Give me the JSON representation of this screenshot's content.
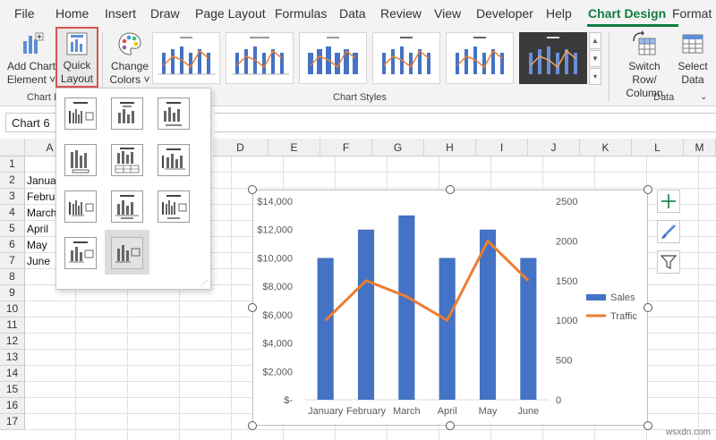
{
  "menu": {
    "tabs": [
      "File",
      "Home",
      "Insert",
      "Draw",
      "Page Layout",
      "Formulas",
      "Data",
      "Review",
      "View",
      "Developer",
      "Help",
      "Chart Design",
      "Format"
    ],
    "active": "Chart Design"
  },
  "ribbon": {
    "add_chart_element": [
      "Add Chart",
      "Element"
    ],
    "quick_layout": [
      "Quick",
      "Layout"
    ],
    "change_colors": [
      "Change",
      "Colors"
    ],
    "switch_row_column": [
      "Switch Row/",
      "Column"
    ],
    "select_data": [
      "Select",
      "Data"
    ],
    "group_chart_layouts": "Chart La",
    "group_chart_styles": "Chart Styles",
    "group_data": "Data"
  },
  "namebox": "Chart 6",
  "columns": [
    "A",
    "D",
    "E",
    "F",
    "G",
    "H",
    "I",
    "J",
    "K",
    "L",
    "M"
  ],
  "rows": [
    "1",
    "2",
    "3",
    "4",
    "5",
    "6",
    "7",
    "8",
    "9",
    "10",
    "11",
    "12",
    "13",
    "14",
    "15",
    "16",
    "17"
  ],
  "cells": [
    "January",
    "Februa",
    "March",
    "April",
    "May",
    "June"
  ],
  "chart_data": {
    "type": "bar",
    "categories": [
      "January",
      "February",
      "March",
      "April",
      "May",
      "June"
    ],
    "series": [
      {
        "name": "Sales",
        "type": "bar",
        "axis": "left",
        "values": [
          10000,
          12000,
          13000,
          10000,
          12000,
          10000
        ],
        "color": "#4472c4"
      },
      {
        "name": "Traffic",
        "type": "line",
        "axis": "right",
        "values": [
          1000,
          1500,
          1300,
          1000,
          2000,
          1500
        ],
        "color": "#ed7d31"
      }
    ],
    "ylim": [
      0,
      14000
    ],
    "y_ticks": [
      "$-",
      "$2,000",
      "$4,000",
      "$6,000",
      "$8,000",
      "$10,000",
      "$12,000",
      "$14,000"
    ],
    "y2lim": [
      0,
      2500
    ],
    "y2_ticks": [
      "0",
      "500",
      "1000",
      "1500",
      "2000",
      "2500"
    ],
    "legend": "right",
    "title": "",
    "xlabel": "",
    "ylabel": ""
  },
  "watermark": "wsxdn.com",
  "colors": {
    "accent": "#107c41",
    "highlight": "#d9534f",
    "bar": "#4472c4",
    "line": "#ed7d31"
  }
}
